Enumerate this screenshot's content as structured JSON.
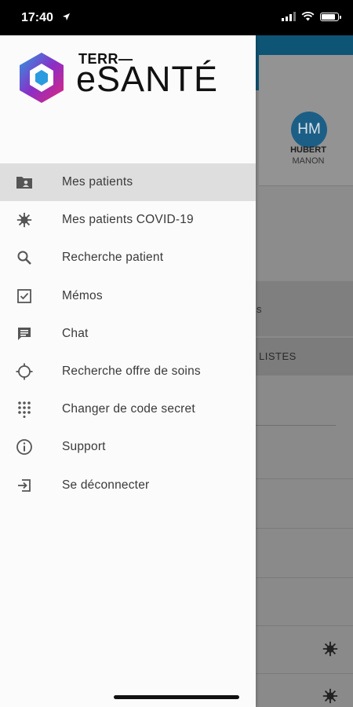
{
  "status_bar": {
    "time": "17:40",
    "icons": [
      "location-arrow-icon",
      "signal-icon",
      "wifi-icon",
      "battery-icon"
    ]
  },
  "logo": {
    "line1": "TERR—",
    "line2": "eSANTÉ",
    "colors": [
      "#2b9be0",
      "#8a2fc7",
      "#e0267a"
    ]
  },
  "menu": {
    "items": [
      {
        "label": "Mes patients",
        "icon": "folder-person-icon",
        "active": true
      },
      {
        "label": "Mes patients COVID-19",
        "icon": "virus-icon",
        "active": false
      },
      {
        "label": "Recherche patient",
        "icon": "search-icon",
        "active": false
      },
      {
        "label": "Mémos",
        "icon": "checkbox-icon",
        "active": false
      },
      {
        "label": "Chat",
        "icon": "chat-icon",
        "active": false
      },
      {
        "label": "Recherche offre de soins",
        "icon": "location-target-icon",
        "active": false
      },
      {
        "label": "Changer de code secret",
        "icon": "dialpad-icon",
        "active": false
      },
      {
        "label": "Support",
        "icon": "info-icon",
        "active": false
      },
      {
        "label": "Se déconnecter",
        "icon": "logout-icon",
        "active": false
      }
    ]
  },
  "background": {
    "avatar_initials": "HM",
    "user_first": "HUBERT",
    "user_last": "MANON",
    "fragment_s": "s",
    "listes_label": "LISTES"
  },
  "colors": {
    "header": "#0e5474",
    "active_item": "#dedede",
    "avatar": "#1c5f86"
  }
}
